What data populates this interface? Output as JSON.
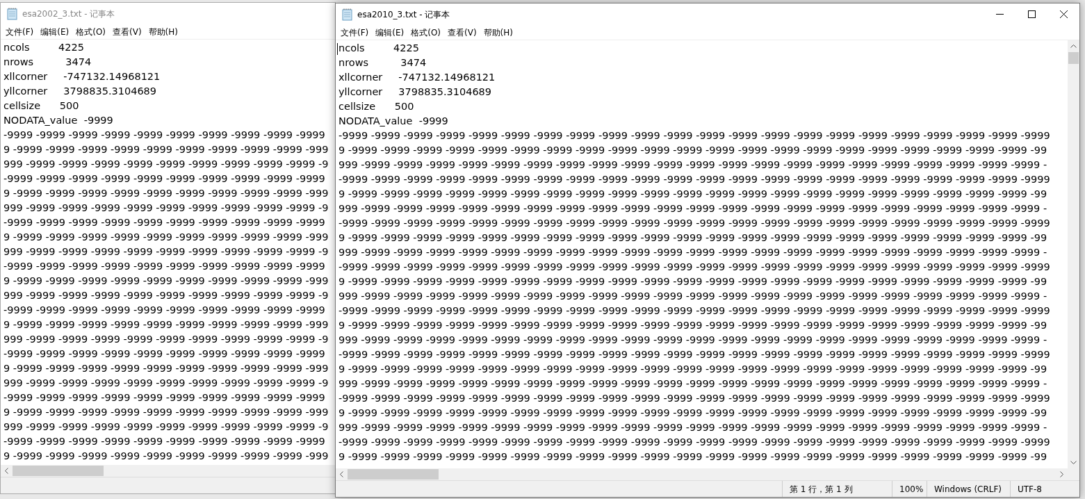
{
  "windows": [
    {
      "title": "esa2002_3.txt - 记事本",
      "active": false,
      "menu": [
        "文件(F)",
        "编辑(E)",
        "格式(O)",
        "查看(V)",
        "帮助(H)"
      ],
      "lines": [
        "ncols         4225",
        "nrows          3474",
        "xllcorner     -747132.14968121",
        "yllcorner     3798835.3104689",
        "cellsize      500",
        "NODATA_value  -9999",
        "-9999 -9999 -9999 -9999 -9999 -9999 -9999 -9999 -9999 -9999",
        "9 -9999 -9999 -9999 -9999 -9999 -9999 -9999 -9999 -9999 -999",
        "999 -9999 -9999 -9999 -9999 -9999 -9999 -9999 -9999 -9999 -9",
        "-9999 -9999 -9999 -9999 -9999 -9999 -9999 -9999 -9999 -9999",
        "9 -9999 -9999 -9999 -9999 -9999 -9999 -9999 -9999 -9999 -999",
        "999 -9999 -9999 -9999 -9999 -9999 -9999 -9999 -9999 -9999 -9",
        "-9999 -9999 -9999 -9999 -9999 -9999 -9999 -9999 -9999 -9999",
        "9 -9999 -9999 -9999 -9999 -9999 -9999 -9999 -9999 -9999 -999",
        "999 -9999 -9999 -9999 -9999 -9999 -9999 -9999 -9999 -9999 -9",
        "-9999 -9999 -9999 -9999 -9999 -9999 -9999 -9999 -9999 -9999",
        "9 -9999 -9999 -9999 -9999 -9999 -9999 -9999 -9999 -9999 -999",
        "999 -9999 -9999 -9999 -9999 -9999 -9999 -9999 -9999 -9999 -9",
        "-9999 -9999 -9999 -9999 -9999 -9999 -9999 -9999 -9999 -9999",
        "9 -9999 -9999 -9999 -9999 -9999 -9999 -9999 -9999 -9999 -999",
        "999 -9999 -9999 -9999 -9999 -9999 -9999 -9999 -9999 -9999 -9",
        "-9999 -9999 -9999 -9999 -9999 -9999 -9999 -9999 -9999 -9999",
        "9 -9999 -9999 -9999 -9999 -9999 -9999 -9999 -9999 -9999 -999",
        "999 -9999 -9999 -9999 -9999 -9999 -9999 -9999 -9999 -9999 -9",
        "-9999 -9999 -9999 -9999 -9999 -9999 -9999 -9999 -9999 -9999",
        "9 -9999 -9999 -9999 -9999 -9999 -9999 -9999 -9999 -9999 -999",
        "999 -9999 -9999 -9999 -9999 -9999 -9999 -9999 -9999 -9999 -9",
        "-9999 -9999 -9999 -9999 -9999 -9999 -9999 -9999 -9999 -9999",
        "9 -9999 -9999 -9999 -9999 -9999 -9999 -9999 -9999 -9999 -999"
      ]
    },
    {
      "title": "esa2010_3.txt - 记事本",
      "active": true,
      "menu": [
        "文件(F)",
        "编辑(E)",
        "格式(O)",
        "查看(V)",
        "帮助(H)"
      ],
      "lines": [
        "ncols         4225",
        "nrows          3474",
        "xllcorner     -747132.14968121",
        "yllcorner     3798835.3104689",
        "cellsize      500",
        "NODATA_value  -9999",
        "-9999 -9999 -9999 -9999 -9999 -9999 -9999 -9999 -9999 -9999 -9999 -9999 -9999 -9999 -9999 -9999 -9999 -9999 -9999 -9999 -9999 -9999",
        "9 -9999 -9999 -9999 -9999 -9999 -9999 -9999 -9999 -9999 -9999 -9999 -9999 -9999 -9999 -9999 -9999 -9999 -9999 -9999 -9999 -9999 -99",
        "999 -9999 -9999 -9999 -9999 -9999 -9999 -9999 -9999 -9999 -9999 -9999 -9999 -9999 -9999 -9999 -9999 -9999 -9999 -9999 -9999 -9999 -",
        "-9999 -9999 -9999 -9999 -9999 -9999 -9999 -9999 -9999 -9999 -9999 -9999 -9999 -9999 -9999 -9999 -9999 -9999 -9999 -9999 -9999 -9999",
        "9 -9999 -9999 -9999 -9999 -9999 -9999 -9999 -9999 -9999 -9999 -9999 -9999 -9999 -9999 -9999 -9999 -9999 -9999 -9999 -9999 -9999 -99",
        "999 -9999 -9999 -9999 -9999 -9999 -9999 -9999 -9999 -9999 -9999 -9999 -9999 -9999 -9999 -9999 -9999 -9999 -9999 -9999 -9999 -9999 -",
        "-9999 -9999 -9999 -9999 -9999 -9999 -9999 -9999 -9999 -9999 -9999 -9999 -9999 -9999 -9999 -9999 -9999 -9999 -9999 -9999 -9999 -9999",
        "9 -9999 -9999 -9999 -9999 -9999 -9999 -9999 -9999 -9999 -9999 -9999 -9999 -9999 -9999 -9999 -9999 -9999 -9999 -9999 -9999 -9999 -99",
        "999 -9999 -9999 -9999 -9999 -9999 -9999 -9999 -9999 -9999 -9999 -9999 -9999 -9999 -9999 -9999 -9999 -9999 -9999 -9999 -9999 -9999 -",
        "-9999 -9999 -9999 -9999 -9999 -9999 -9999 -9999 -9999 -9999 -9999 -9999 -9999 -9999 -9999 -9999 -9999 -9999 -9999 -9999 -9999 -9999",
        "9 -9999 -9999 -9999 -9999 -9999 -9999 -9999 -9999 -9999 -9999 -9999 -9999 -9999 -9999 -9999 -9999 -9999 -9999 -9999 -9999 -9999 -99",
        "999 -9999 -9999 -9999 -9999 -9999 -9999 -9999 -9999 -9999 -9999 -9999 -9999 -9999 -9999 -9999 -9999 -9999 -9999 -9999 -9999 -9999 -",
        "-9999 -9999 -9999 -9999 -9999 -9999 -9999 -9999 -9999 -9999 -9999 -9999 -9999 -9999 -9999 -9999 -9999 -9999 -9999 -9999 -9999 -9999",
        "9 -9999 -9999 -9999 -9999 -9999 -9999 -9999 -9999 -9999 -9999 -9999 -9999 -9999 -9999 -9999 -9999 -9999 -9999 -9999 -9999 -9999 -99",
        "999 -9999 -9999 -9999 -9999 -9999 -9999 -9999 -9999 -9999 -9999 -9999 -9999 -9999 -9999 -9999 -9999 -9999 -9999 -9999 -9999 -9999 -",
        "-9999 -9999 -9999 -9999 -9999 -9999 -9999 -9999 -9999 -9999 -9999 -9999 -9999 -9999 -9999 -9999 -9999 -9999 -9999 -9999 -9999 -9999",
        "9 -9999 -9999 -9999 -9999 -9999 -9999 -9999 -9999 -9999 -9999 -9999 -9999 -9999 -9999 -9999 -9999 -9999 -9999 -9999 -9999 -9999 -99",
        "999 -9999 -9999 -9999 -9999 -9999 -9999 -9999 -9999 -9999 -9999 -9999 -9999 -9999 -9999 -9999 -9999 -9999 -9999 -9999 -9999 -9999 -",
        "-9999 -9999 -9999 -9999 -9999 -9999 -9999 -9999 -9999 -9999 -9999 -9999 -9999 -9999 -9999 -9999 -9999 -9999 -9999 -9999 -9999 -9999",
        "9 -9999 -9999 -9999 -9999 -9999 -9999 -9999 -9999 -9999 -9999 -9999 -9999 -9999 -9999 -9999 -9999 -9999 -9999 -9999 -9999 -9999 -99",
        "999 -9999 -9999 -9999 -9999 -9999 -9999 -9999 -9999 -9999 -9999 -9999 -9999 -9999 -9999 -9999 -9999 -9999 -9999 -9999 -9999 -9999 -",
        "-9999 -9999 -9999 -9999 -9999 -9999 -9999 -9999 -9999 -9999 -9999 -9999 -9999 -9999 -9999 -9999 -9999 -9999 -9999 -9999 -9999 -9999",
        "9 -9999 -9999 -9999 -9999 -9999 -9999 -9999 -9999 -9999 -9999 -9999 -9999 -9999 -9999 -9999 -9999 -9999 -9999 -9999 -9999 -9999 -99"
      ],
      "status": [
        "第 1 行，第 1 列",
        "100%",
        "Windows (CRLF)",
        "UTF-8"
      ]
    }
  ]
}
